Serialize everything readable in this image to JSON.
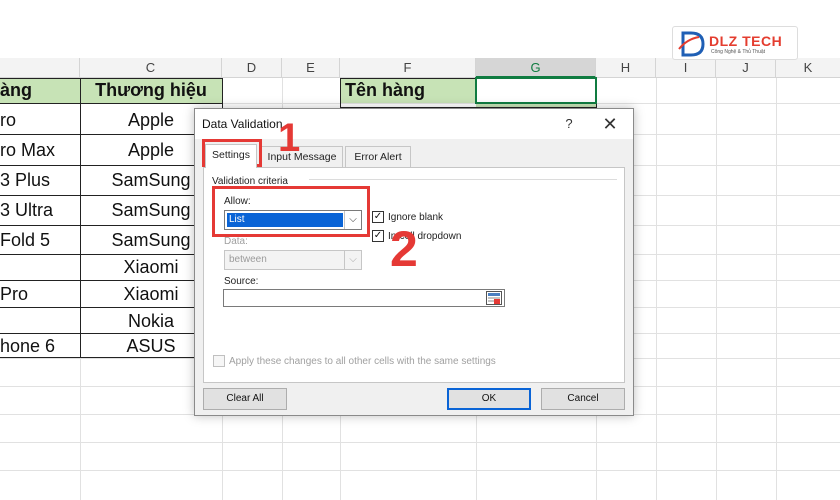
{
  "spreadsheet": {
    "columns": [
      "C",
      "D",
      "E",
      "F",
      "G",
      "H",
      "I",
      "J",
      "K"
    ],
    "selected_column": "G",
    "col_b_header": "àng",
    "col_c_header": "Thương hiệu",
    "col_f_header": "Tên hàng",
    "products": [
      "ro",
      "ro Max",
      "3 Plus",
      "3 Ultra",
      "Fold 5",
      "",
      "Pro",
      "",
      "hone 6"
    ],
    "brands": [
      "Apple",
      "Apple",
      "SamSung",
      "SamSung",
      "SamSung",
      "Xiaomi",
      "Xiaomi",
      "Nokia",
      "ASUS"
    ]
  },
  "logo": {
    "text": "DLZ TECH",
    "tagline": "Công Nghệ & Thủ Thuật",
    "accent_color": "#e43d2f"
  },
  "dialog": {
    "title": "Data Validation",
    "help_label": "?",
    "close_label": "✕",
    "tabs": [
      "Settings",
      "Input Message",
      "Error Alert"
    ],
    "active_tab": "Settings",
    "criteria_label": "Validation criteria",
    "allow_label": "Allow:",
    "allow_value": "List",
    "data_label": "Data:",
    "data_value": "between",
    "ignore_blank_label": "Ignore blank",
    "ignore_blank_checked": true,
    "in_cell_dropdown_label": "In-cell dropdown",
    "in_cell_dropdown_checked": true,
    "source_label": "Source:",
    "source_value": "",
    "apply_all_label": "Apply these changes to all other cells with the same settings",
    "apply_all_checked": false,
    "buttons": {
      "clear_all": "Clear All",
      "ok": "OK",
      "cancel": "Cancel"
    }
  },
  "annotations": {
    "step1": "1",
    "step2": "2",
    "color": "#e53935"
  },
  "icons": {
    "dropdown": "chevron-down-icon",
    "range_selector": "range-select-icon",
    "close": "close-icon",
    "help": "help-icon"
  }
}
